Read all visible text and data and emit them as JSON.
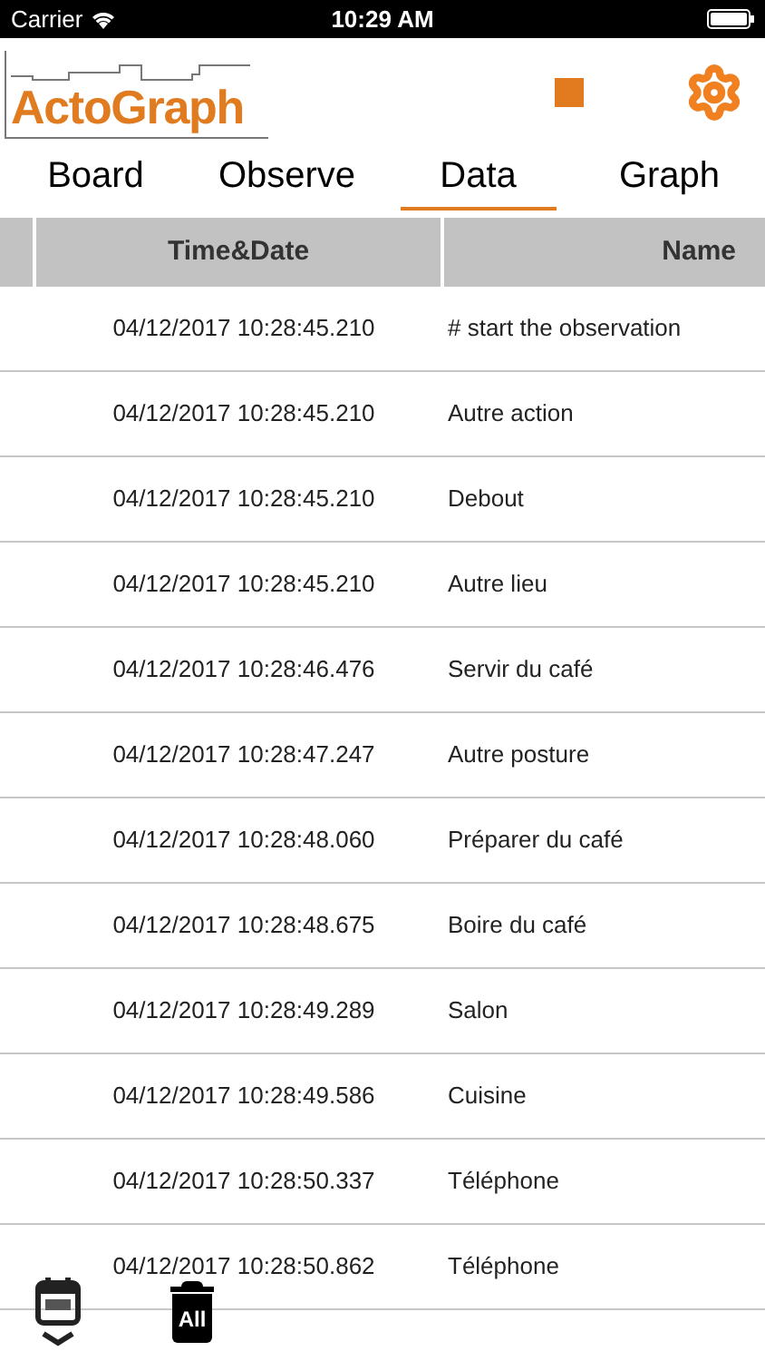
{
  "status_bar": {
    "carrier": "Carrier",
    "time": "10:29 AM"
  },
  "header": {
    "logo_text": "ActoGraph"
  },
  "tabs": [
    {
      "label": "Board",
      "selected": false
    },
    {
      "label": "Observe",
      "selected": false
    },
    {
      "label": "Data",
      "selected": true
    },
    {
      "label": "Graph",
      "selected": false
    }
  ],
  "table": {
    "columns": [
      "Time&Date",
      "Name"
    ],
    "rows": [
      {
        "time": "04/12/2017 10:28:45.210",
        "name": "# start the observation"
      },
      {
        "time": "04/12/2017 10:28:45.210",
        "name": "Autre action"
      },
      {
        "time": "04/12/2017 10:28:45.210",
        "name": "Debout"
      },
      {
        "time": "04/12/2017 10:28:45.210",
        "name": "Autre lieu"
      },
      {
        "time": "04/12/2017 10:28:46.476",
        "name": "Servir du café"
      },
      {
        "time": "04/12/2017 10:28:47.247",
        "name": "Autre posture"
      },
      {
        "time": "04/12/2017 10:28:48.060",
        "name": "Préparer du café"
      },
      {
        "time": "04/12/2017 10:28:48.675",
        "name": "Boire du café"
      },
      {
        "time": "04/12/2017 10:28:49.289",
        "name": "Salon"
      },
      {
        "time": "04/12/2017 10:28:49.586",
        "name": "Cuisine"
      },
      {
        "time": "04/12/2017 10:28:50.337",
        "name": "Téléphone"
      },
      {
        "time": "04/12/2017 10:28:50.862",
        "name": "Téléphone"
      }
    ]
  },
  "toolbar": {
    "delete_all_label": "All"
  }
}
